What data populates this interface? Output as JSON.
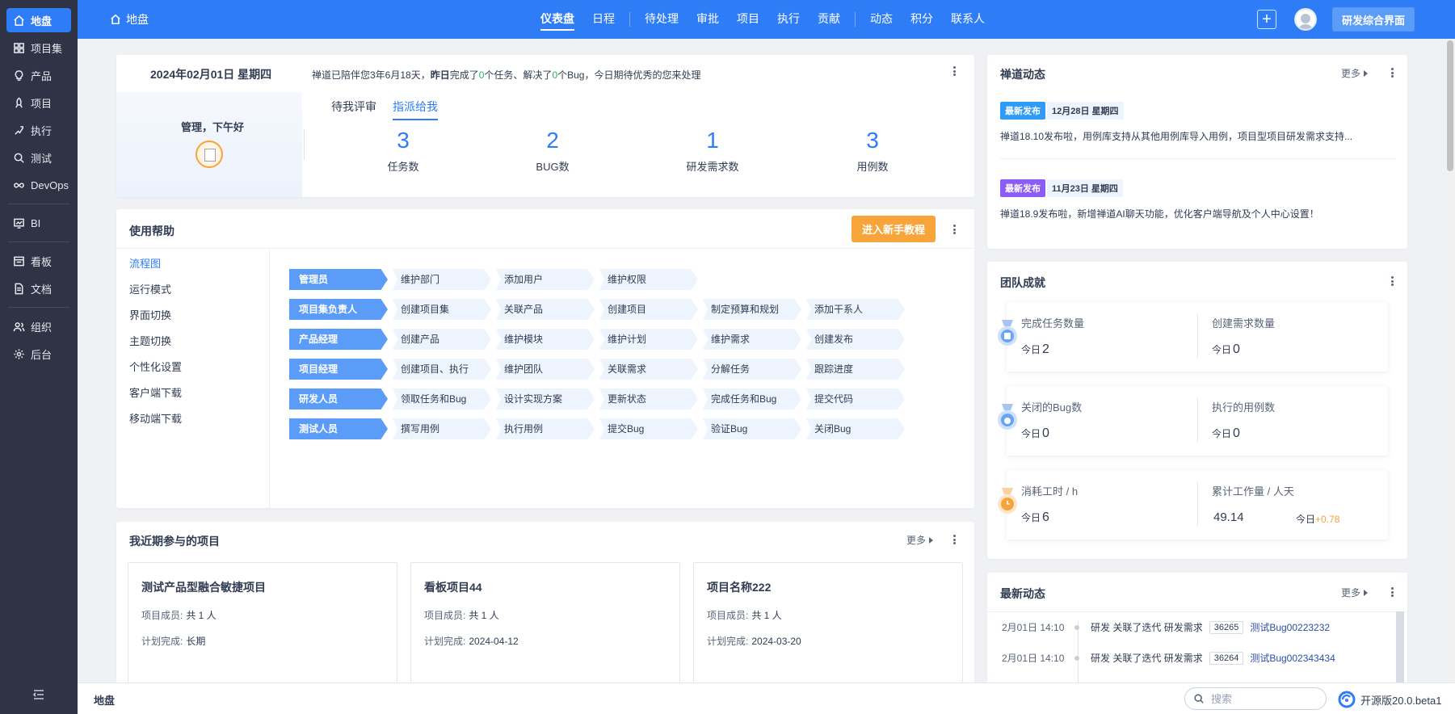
{
  "sidebar": {
    "items": [
      {
        "label": "地盘",
        "icon": "home-icon"
      },
      {
        "label": "项目集",
        "icon": "grid-icon"
      },
      {
        "label": "产品",
        "icon": "lightbulb-icon"
      },
      {
        "label": "项目",
        "icon": "rocket-icon"
      },
      {
        "label": "执行",
        "icon": "run-icon"
      },
      {
        "label": "测试",
        "icon": "search-bug-icon"
      },
      {
        "label": "DevOps",
        "icon": "infinity-icon"
      },
      {
        "label": "BI",
        "icon": "chart-icon"
      },
      {
        "label": "看板",
        "icon": "kanban-icon"
      },
      {
        "label": "文档",
        "icon": "document-icon"
      },
      {
        "label": "组织",
        "icon": "people-icon"
      },
      {
        "label": "后台",
        "icon": "gear-icon"
      }
    ]
  },
  "topbar": {
    "home_label": "地盘",
    "menu": [
      "仪表盘",
      "日程",
      "待处理",
      "审批",
      "项目",
      "执行",
      "贡献",
      "动态",
      "积分",
      "联系人"
    ],
    "switch_label": "研发综合界面",
    "plus_label": "+"
  },
  "welcome": {
    "date": "2024年02月01日 星期四",
    "summary_a": "禅道已陪伴您3年6月18天，",
    "summary_b": "昨日",
    "summary_c": "完成了",
    "summary_d": "0",
    "summary_e": "个任务、解决了",
    "summary_f": "0",
    "summary_g": "个Bug，今日期待优秀的您来处理",
    "greeting": "管理，下午好",
    "tabs": [
      "待我评审",
      "指派给我"
    ],
    "stats": [
      {
        "num": "3",
        "label": "任务数"
      },
      {
        "num": "2",
        "label": "BUG数"
      },
      {
        "num": "1",
        "label": "研发需求数"
      },
      {
        "num": "3",
        "label": "用例数"
      }
    ]
  },
  "help": {
    "title": "使用帮助",
    "cta": "进入新手教程",
    "side": [
      "流程图",
      "运行模式",
      "界面切换",
      "主题切换",
      "个性化设置",
      "客户端下载",
      "移动端下载"
    ],
    "rows": [
      {
        "role": "管理员",
        "steps": [
          "维护部门",
          "添加用户",
          "维护权限"
        ]
      },
      {
        "role": "项目集负责人",
        "steps": [
          "创建项目集",
          "关联产品",
          "创建项目",
          "制定预算和规划",
          "添加干系人"
        ]
      },
      {
        "role": "产品经理",
        "steps": [
          "创建产品",
          "维护模块",
          "维护计划",
          "维护需求",
          "创建发布"
        ]
      },
      {
        "role": "项目经理",
        "steps": [
          "创建项目、执行",
          "维护团队",
          "关联需求",
          "分解任务",
          "跟踪进度"
        ]
      },
      {
        "role": "研发人员",
        "steps": [
          "领取任务和Bug",
          "设计实现方案",
          "更新状态",
          "完成任务和Bug",
          "提交代码"
        ]
      },
      {
        "role": "测试人员",
        "steps": [
          "撰写用例",
          "执行用例",
          "提交Bug",
          "验证Bug",
          "关闭Bug"
        ]
      }
    ]
  },
  "projects": {
    "title": "我近期参与的项目",
    "more": "更多",
    "member_label": "项目成员:",
    "plan_label": "计划完成:",
    "cards": [
      {
        "name": "测试产品型融合敏捷项目",
        "members": "共 1 人",
        "plan": "长期"
      },
      {
        "name": "看板项目44",
        "members": "共 1 人",
        "plan": "2024-04-12"
      },
      {
        "name": "项目名称222",
        "members": "共 1 人",
        "plan": "2024-03-20"
      }
    ]
  },
  "news": {
    "title": "禅道动态",
    "more": "更多",
    "items": [
      {
        "badge": "最新发布",
        "date": "12月28日 星期四",
        "text": "禅道18.10发布啦，用例库支持从其他用例库导入用例，项目型项目研发需求支持..."
      },
      {
        "badge": "最新发布",
        "date": "11月23日 星期四",
        "text": "禅道18.9发布啦，新增禅道AI聊天功能，优化客户端导航及个人中心设置！"
      }
    ]
  },
  "team": {
    "title": "团队成就",
    "today": "今日",
    "boxes": [
      [
        {
          "label": "完成任务数量",
          "value": "2"
        },
        {
          "label": "创建需求数量",
          "value": "0"
        }
      ],
      [
        {
          "label": "关闭的Bug数",
          "value": "0"
        },
        {
          "label": "执行的用例数",
          "value": "0"
        }
      ],
      [
        {
          "label": "消耗工时 / h",
          "value": "6"
        },
        {
          "label": "累计工作量 / 人天",
          "total": "49.14",
          "delta": "+0.78"
        }
      ]
    ]
  },
  "activity": {
    "title": "最新动态",
    "more": "更多",
    "events": [
      {
        "time": "2月01日 14:10",
        "actor": "研发",
        "action": "关联了迭代",
        "type": "研发需求",
        "id": "36265",
        "link": "测试Bug00223232"
      },
      {
        "time": "2月01日 14:10",
        "actor": "研发",
        "action": "关联了迭代",
        "type": "研发需求",
        "id": "36264",
        "link": "测试Bug002343434"
      }
    ]
  },
  "footer": {
    "breadcrumb": "地盘",
    "search_placeholder": "搜索",
    "version": "开源版20.0.beta1"
  },
  "colors": {
    "primary": "#2e7cf6",
    "sidebar_bg": "#2e3445",
    "cta_orange": "#f7a43a",
    "success_green": "#22b45f"
  }
}
